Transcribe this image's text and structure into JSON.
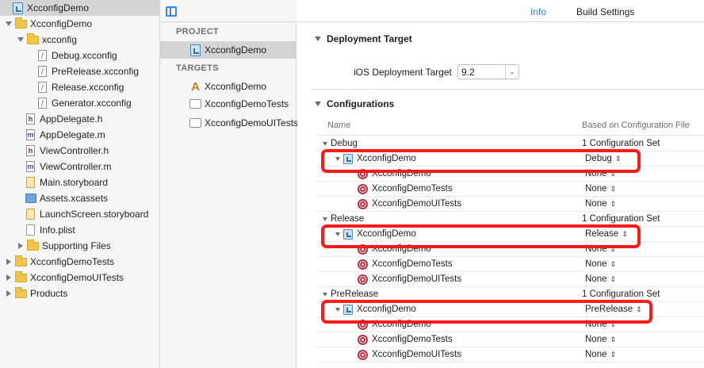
{
  "navigator": {
    "items": [
      {
        "label": "XcconfigDemo",
        "icon": "project-icon",
        "disclosure": "none",
        "selected": true
      },
      {
        "label": "XcconfigDemo",
        "icon": "folder-icon",
        "disclosure": "open"
      },
      {
        "label": "xcconfig",
        "icon": "folder-icon",
        "disclosure": "open"
      },
      {
        "label": "Debug.xcconfig",
        "icon": "xcconfig-file-icon"
      },
      {
        "label": "PreRelease.xcconfig",
        "icon": "xcconfig-file-icon"
      },
      {
        "label": "Release.xcconfig",
        "icon": "xcconfig-file-icon"
      },
      {
        "label": "Generator.xcconfig",
        "icon": "xcconfig-file-icon"
      },
      {
        "label": "AppDelegate.h",
        "icon": "header-file-icon"
      },
      {
        "label": "AppDelegate.m",
        "icon": "objc-file-icon"
      },
      {
        "label": "ViewController.h",
        "icon": "header-file-icon"
      },
      {
        "label": "ViewController.m",
        "icon": "objc-file-icon"
      },
      {
        "label": "Main.storyboard",
        "icon": "storyboard-icon"
      },
      {
        "label": "Assets.xcassets",
        "icon": "asset-catalog-icon"
      },
      {
        "label": "LaunchScreen.storyboard",
        "icon": "storyboard-icon"
      },
      {
        "label": "Info.plist",
        "icon": "plist-file-icon"
      },
      {
        "label": "Supporting Files",
        "icon": "folder-icon",
        "disclosure": "closed"
      },
      {
        "label": "XcconfigDemoTests",
        "icon": "folder-icon",
        "disclosure": "closed"
      },
      {
        "label": "XcconfigDemoUITests",
        "icon": "folder-icon",
        "disclosure": "closed"
      },
      {
        "label": "Products",
        "icon": "folder-icon",
        "disclosure": "closed"
      }
    ]
  },
  "targets_panel": {
    "project_header": "PROJECT",
    "project_item": "XcconfigDemo",
    "targets_header": "TARGETS",
    "targets": [
      "XcconfigDemo",
      "XcconfigDemoTests",
      "XcconfigDemoUITests"
    ]
  },
  "tabs": {
    "info": "Info",
    "build_settings": "Build Settings"
  },
  "deployment": {
    "title": "Deployment Target",
    "label": "iOS Deployment Target",
    "value": "9.2"
  },
  "configurations": {
    "title": "Configurations",
    "col_name": "Name",
    "col_based_on": "Based on Configuration File",
    "groups": [
      {
        "name": "Debug",
        "summary": "1 Configuration Set",
        "project": {
          "name": "XcconfigDemo",
          "value": "Debug"
        },
        "targets": [
          {
            "name": "XcconfigDemo",
            "value": "None"
          },
          {
            "name": "XcconfigDemoTests",
            "value": "None"
          },
          {
            "name": "XcconfigDemoUITests",
            "value": "None"
          }
        ]
      },
      {
        "name": "Release",
        "summary": "1 Configuration Set",
        "project": {
          "name": "XcconfigDemo",
          "value": "Release"
        },
        "targets": [
          {
            "name": "XcconfigDemo",
            "value": "None"
          },
          {
            "name": "XcconfigDemoTests",
            "value": "None"
          },
          {
            "name": "XcconfigDemoUITests",
            "value": "None"
          }
        ]
      },
      {
        "name": "PreRelease",
        "summary": "1 Configuration Set",
        "project": {
          "name": "XcconfigDemo",
          "value": "PreRelease"
        },
        "targets": [
          {
            "name": "XcconfigDemo",
            "value": "None"
          },
          {
            "name": "XcconfigDemoTests",
            "value": "None"
          },
          {
            "name": "XcconfigDemoUITests",
            "value": "None"
          }
        ]
      }
    ]
  },
  "colors": {
    "accent": "#2f7de1",
    "highlight": "#ff1a1a",
    "selection": "#d5d5d5"
  }
}
